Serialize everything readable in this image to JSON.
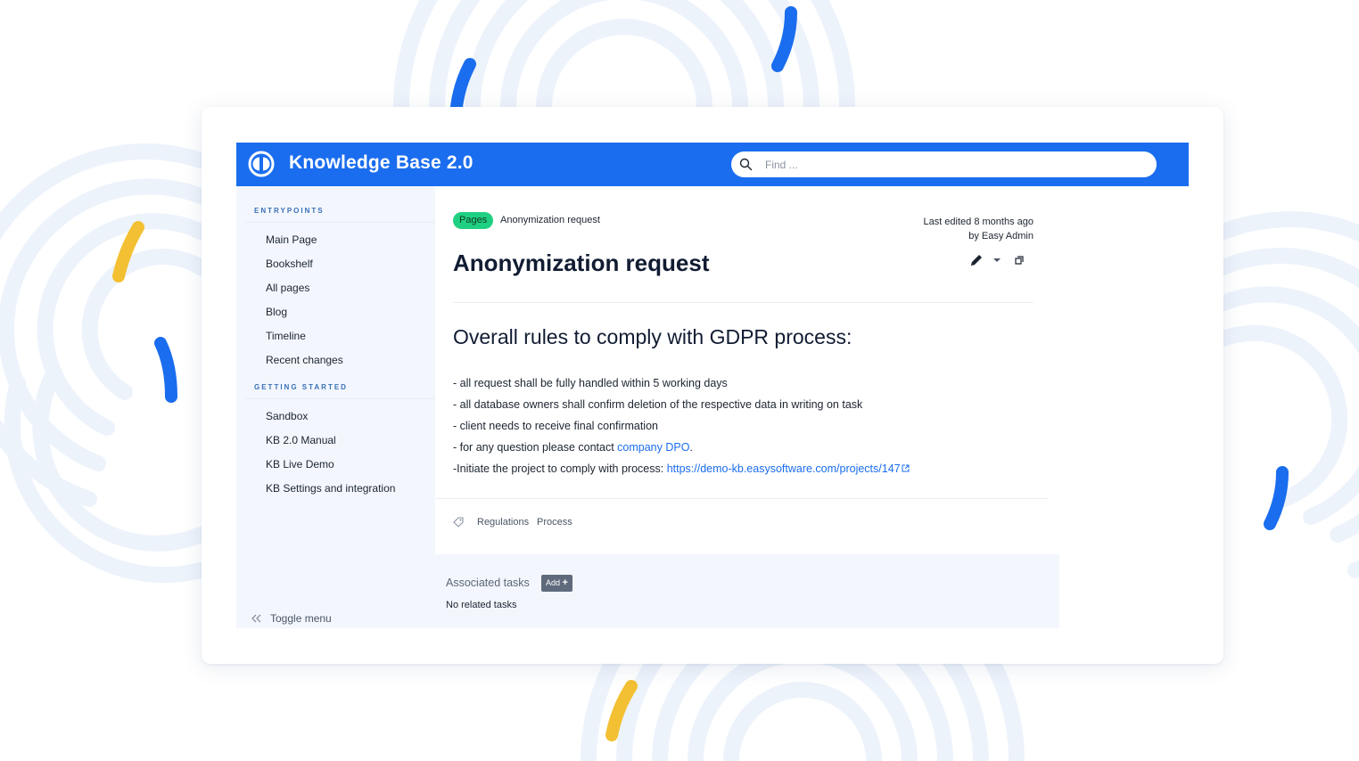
{
  "header": {
    "title": "Knowledge Base 2.0",
    "search_placeholder": "Find ...",
    "bar_color": "#1a6dee"
  },
  "sidebar": {
    "sections": [
      {
        "label": "ENTRYPOINTS",
        "items": [
          "Main Page",
          "Bookshelf",
          "All pages",
          "Blog",
          "Timeline",
          "Recent changes"
        ]
      },
      {
        "label": "GETTING STARTED",
        "items": [
          "Sandbox",
          "KB 2.0 Manual",
          "KB Live Demo",
          "KB Settings and integration"
        ]
      }
    ],
    "toggle_label": "Toggle menu"
  },
  "page": {
    "badge": "Pages",
    "breadcrumb": "Anonymization request",
    "last_edited_prefix": "Last edited",
    "last_edited_time": "8 months ago",
    "last_edited_by": "by Easy Admin",
    "title": "Anonymization request",
    "heading": "Overall rules to comply with GDPR process:",
    "lines": [
      "- all request shall be fully handled within 5 working days",
      "- all database owners shall confirm deletion of the respective data in writing on task",
      "- client needs to receive final confirmation"
    ],
    "contact_prefix": "- for any question please contact ",
    "contact_link": "company DPO",
    "contact_suffix": ".",
    "project_prefix": "-Initiate the project to comply with process: ",
    "project_link": "https://demo-kb.easysoftware.com/projects/147",
    "tags": [
      "Regulations",
      "Process"
    ]
  },
  "tasks": {
    "title": "Associated tasks",
    "add_label": "Add",
    "empty": "No related tasks"
  },
  "colors": {
    "accent": "#1a6dee",
    "badge": "#20d082",
    "link": "#1a6dee",
    "decor_yellow": "#f3c033"
  }
}
